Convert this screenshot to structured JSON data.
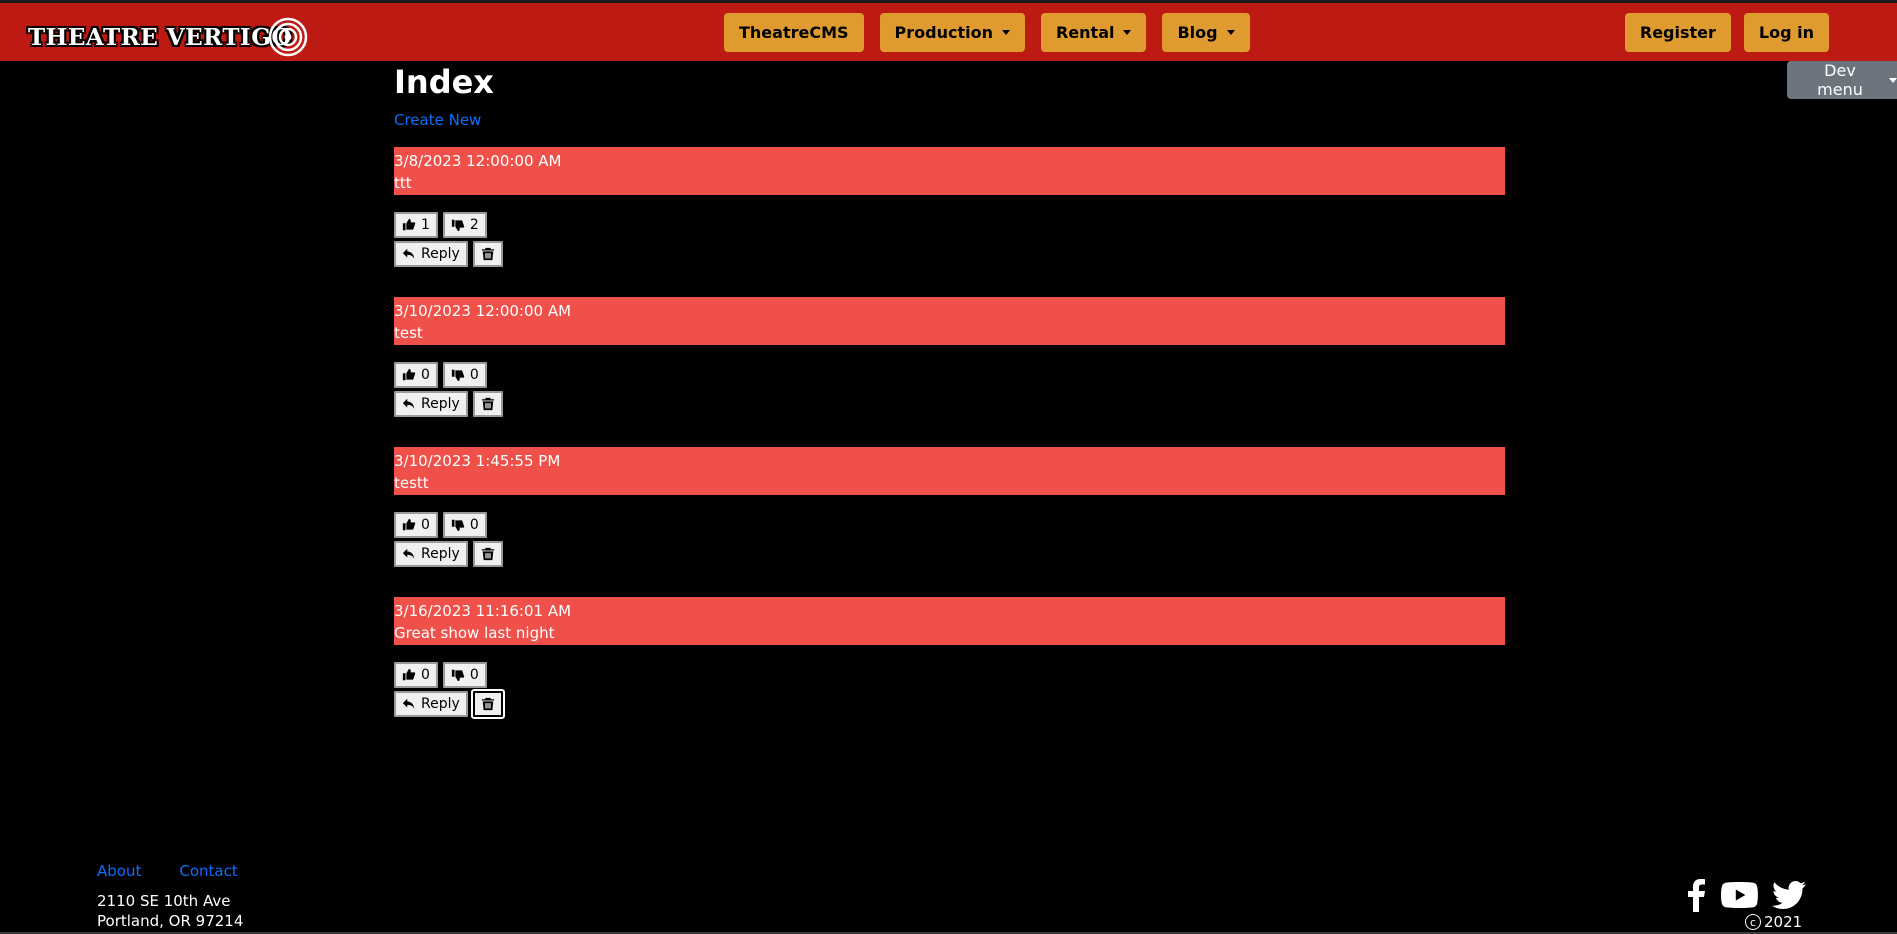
{
  "brand": {
    "name": "THEATRE VERTIGO"
  },
  "nav": {
    "center": [
      {
        "label": "TheatreCMS",
        "dropdown": false
      },
      {
        "label": "Production",
        "dropdown": true
      },
      {
        "label": "Rental",
        "dropdown": true
      },
      {
        "label": "Blog",
        "dropdown": true
      }
    ],
    "register": "Register",
    "login": "Log in"
  },
  "dev_menu": "Dev menu",
  "page": {
    "title": "Index",
    "create_link": "Create New"
  },
  "comments": [
    {
      "date": "3/8/2023 12:00:00 AM",
      "text": "ttt",
      "likes": "1",
      "dislikes": "2",
      "reply": "Reply"
    },
    {
      "date": "3/10/2023 12:00:00 AM",
      "text": "test",
      "likes": "0",
      "dislikes": "0",
      "reply": "Reply"
    },
    {
      "date": "3/10/2023 1:45:55 PM",
      "text": "testt",
      "likes": "0",
      "dislikes": "0",
      "reply": "Reply"
    },
    {
      "date": "3/16/2023 11:16:01 AM",
      "text": "Great show last night",
      "likes": "0",
      "dislikes": "0",
      "reply": "Reply"
    }
  ],
  "footer": {
    "links": [
      "About",
      "Contact"
    ],
    "address_line1": "2110 SE 10th Ave",
    "address_line2": "Portland, OR 97214",
    "copyright_year": "2021",
    "social": [
      "facebook-icon",
      "youtube-icon",
      "twitter-icon"
    ]
  },
  "colors": {
    "navbar": "#be1a14",
    "nav_button": "#df9b2f",
    "comment_background": "#ef5049",
    "link": "#0d6efd",
    "dev_menu": "#6c757d"
  }
}
